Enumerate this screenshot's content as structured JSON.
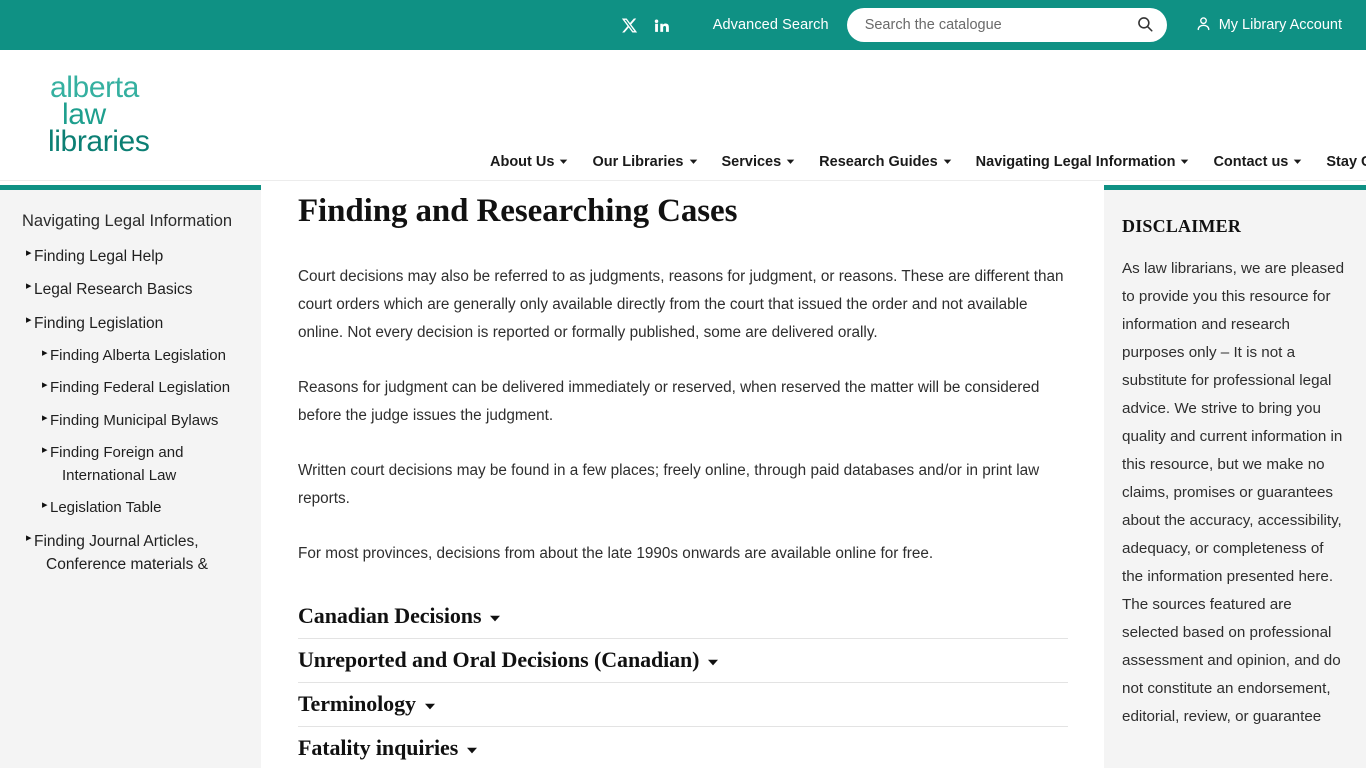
{
  "topbar": {
    "social": [
      {
        "name": "x-twitter-icon",
        "label": "X"
      },
      {
        "name": "linkedin-icon",
        "label": "in"
      }
    ],
    "advanced_search_label": "Advanced Search",
    "search_placeholder": "Search the catalogue",
    "search_value": "",
    "search_icon": "search-icon",
    "account_label": "My Library Account",
    "account_icon": "user-icon",
    "background_color": "#0f9184"
  },
  "masthead": {
    "logo": {
      "line1": "alberta",
      "line2": "law",
      "line3": "libraries"
    },
    "nav": [
      {
        "label": "About Us",
        "has_dropdown": true
      },
      {
        "label": "Our Libraries",
        "has_dropdown": true
      },
      {
        "label": "Services",
        "has_dropdown": true
      },
      {
        "label": "Research Guides",
        "has_dropdown": true
      },
      {
        "label": "Navigating Legal Information",
        "has_dropdown": true
      },
      {
        "label": "Contact us",
        "has_dropdown": true
      },
      {
        "label": "Stay Current",
        "has_dropdown": true
      }
    ]
  },
  "left_sidebar": {
    "title": "Navigating Legal Information",
    "accent_color": "#0f9184",
    "items": [
      {
        "label": "Finding Legal Help",
        "level": 1
      },
      {
        "label": "Legal Research Basics",
        "level": 1
      },
      {
        "label": "Finding Legislation",
        "level": 1
      },
      {
        "label": "Finding Alberta Legislation",
        "level": 2
      },
      {
        "label": "Finding Federal Legislation",
        "level": 2
      },
      {
        "label": "Finding Municipal Bylaws",
        "level": 2
      },
      {
        "label": "Finding Foreign and International Law",
        "level": 2
      },
      {
        "label": "Legislation Table",
        "level": 2
      },
      {
        "label": "Finding Journal Articles, Conference materials &",
        "level": 1
      }
    ]
  },
  "main": {
    "title": "Finding and Researching Cases",
    "paragraphs": [
      "Court decisions may also be referred to as judgments, reasons for judgment, or reasons. These are different than court orders which are generally only available directly from the court that issued the order and not available online. Not every decision is reported or formally published, some are delivered orally.",
      "Reasons for judgment can be delivered immediately or reserved, when reserved the matter will be considered before the judge issues the judgment.",
      "Written court decisions may be found in a few places; freely online, through paid databases and/or in print law reports.",
      "For most provinces, decisions from about the late 1990s onwards are available online for free."
    ],
    "accordions": [
      {
        "label": "Canadian Decisions",
        "expanded": false
      },
      {
        "label": "Unreported and Oral Decisions (Canadian)",
        "expanded": false
      },
      {
        "label": "Terminology",
        "expanded": false
      },
      {
        "label": "Fatality inquiries",
        "expanded": false
      }
    ]
  },
  "right_sidebar": {
    "accent_color": "#0f9184",
    "title": "DISCLAIMER",
    "body": "As law librarians, we are pleased to provide you this resource for information and research purposes only – It is not a substitute for professional legal advice. We strive to bring you quality and current information in this resource, but we make no claims, promises or guarantees about the accuracy, accessibility, adequacy, or completeness of the information presented here. The sources featured are selected based on professional assessment and opinion, and do not constitute an endorsement, editorial, review, or guarantee"
  }
}
